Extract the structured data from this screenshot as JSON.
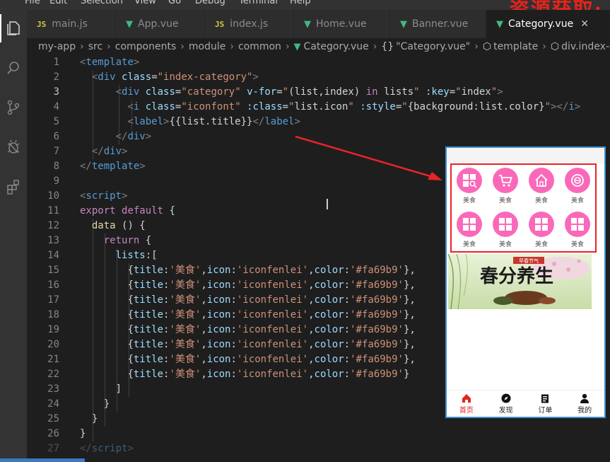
{
  "menubar": {
    "items": [
      "File",
      "Edit",
      "Selection",
      "View",
      "Go",
      "Debug",
      "Terminal",
      "Help"
    ],
    "watermark": "资源获取:"
  },
  "tabs": [
    {
      "label": "main.js",
      "type": "js"
    },
    {
      "label": "App.vue",
      "type": "vue"
    },
    {
      "label": "index.js",
      "type": "js"
    },
    {
      "label": "Home.vue",
      "type": "vue"
    },
    {
      "label": "Banner.vue",
      "type": "vue"
    },
    {
      "label": "Category.vue",
      "type": "vue",
      "active": true
    }
  ],
  "breadcrumb": {
    "items": [
      "my-app",
      "src",
      "components",
      "module",
      "common",
      "Category.vue",
      "\"Category.vue\"",
      "template",
      "div.index-category"
    ]
  },
  "editor": {
    "current_line": 3,
    "line_numbers": [
      1,
      2,
      3,
      4,
      5,
      6,
      7,
      8,
      9,
      10,
      11,
      12,
      13,
      14,
      15,
      16,
      17,
      18,
      19,
      20,
      21,
      22,
      23,
      24,
      25,
      26,
      27
    ]
  },
  "preview": {
    "category_label": "美食",
    "icon_color": "#fa69b9",
    "banner": {
      "title": "春分养生",
      "tag": "早春节气"
    },
    "tabbar": [
      {
        "label": "首页",
        "icon": "home-icon",
        "active": true
      },
      {
        "label": "发现",
        "icon": "compass-icon"
      },
      {
        "label": "订单",
        "icon": "clipboard-icon"
      },
      {
        "label": "我的",
        "icon": "user-icon"
      }
    ]
  },
  "colors": {
    "accent": "#3c79c2",
    "arrow": "#e8232a"
  }
}
